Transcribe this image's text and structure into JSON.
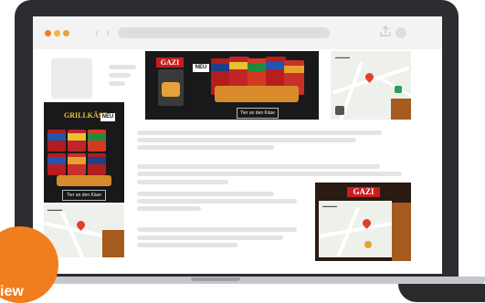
{
  "browser": {
    "nav_arrows": "‹ ›",
    "share_icon": "share-icon",
    "window_dots": [
      "#f07d1e",
      "#f6b045",
      "#e8a040"
    ]
  },
  "ads": {
    "banner": {
      "brand": "GAZI",
      "neu_tag": "NEU",
      "cta": "Tier an den Käse"
    },
    "skyscraper": {
      "headline": "GRILLKÄSE",
      "neu_tag": "NEU",
      "cta": "Tier an den Käse"
    },
    "rectangle": {
      "brand": "GAZI"
    }
  },
  "badge": {
    "label": "iew",
    "color": "#f07d1e"
  },
  "colors": {
    "laptop": "#2c2d30",
    "ad_background": "#19191b",
    "brand_red": "#c71d1e",
    "accent_orange": "#f07d1e"
  }
}
